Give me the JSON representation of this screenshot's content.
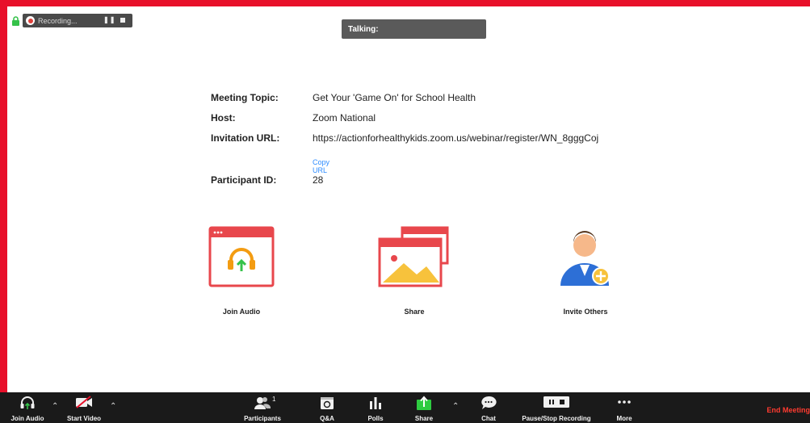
{
  "recording": {
    "label": "Recording..."
  },
  "talking": {
    "label": "Talking:"
  },
  "meeting": {
    "topic_label": "Meeting Topic:",
    "topic": "Get Your 'Game On' for School Health",
    "host_label": "Host:",
    "host": "Zoom National",
    "url_label": "Invitation URL:",
    "url": "https://actionforhealthykids.zoom.us/webinar/register/WN_8gggCoj",
    "copy_url": "Copy URL",
    "participant_label": "Participant ID:",
    "participant_id": "28"
  },
  "actions": {
    "join_audio": "Join Audio",
    "share": "Share",
    "invite_others": "Invite Others"
  },
  "toolbar": {
    "join_audio": "Join Audio",
    "start_video": "Start Video",
    "participants": "Participants",
    "participants_count": "1",
    "qa": "Q&A",
    "polls": "Polls",
    "share": "Share",
    "chat": "Chat",
    "pause_stop_recording": "Pause/Stop Recording",
    "more": "More",
    "end_meeting": "End Meeting"
  },
  "colors": {
    "frame": "#e8102a",
    "toolbar_bg": "#1a1a1a",
    "share_green": "#2ecc40",
    "end_red": "#ff3b30",
    "link_blue": "#2d8cff",
    "card_red": "#e8474c"
  },
  "icons": [
    "lock-icon",
    "recording-icon",
    "headphones-icon",
    "video-off-icon",
    "participants-icon",
    "qa-icon",
    "polls-icon",
    "share-icon",
    "chat-icon",
    "recording-controls-icon",
    "more-icon"
  ]
}
